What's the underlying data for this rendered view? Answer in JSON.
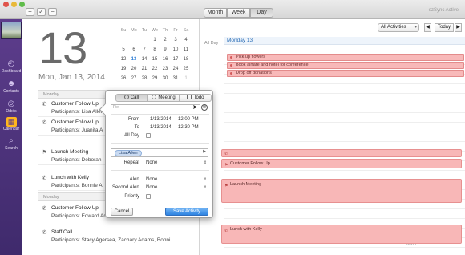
{
  "toolbar": {
    "add_label": "+",
    "check_label": "✓",
    "minus_label": "−",
    "view_modes": [
      "Month",
      "Week",
      "Day"
    ],
    "active_view": "Day",
    "brand": "ezSync Active"
  },
  "sidebar": {
    "items": [
      {
        "label": "Dashboard",
        "glyph": "⌚"
      },
      {
        "label": "Contacts",
        "glyph": "👥"
      },
      {
        "label": "Orbits",
        "glyph": "◍"
      },
      {
        "label": "Calendar",
        "glyph": "▦"
      },
      {
        "label": "Search",
        "glyph": "🔍"
      }
    ],
    "active": "Calendar"
  },
  "day_panel": {
    "big_day": "13",
    "date_line": "Mon, Jan 13, 2014"
  },
  "mini_calendar": {
    "headers": [
      "Su",
      "Mo",
      "Tu",
      "We",
      "Th",
      "Fr",
      "Sa"
    ],
    "weeks": [
      [
        "",
        "",
        "",
        "1",
        "2",
        "3",
        "4"
      ],
      [
        "5",
        "6",
        "7",
        "8",
        "9",
        "10",
        "11"
      ],
      [
        "12",
        "13",
        "14",
        "15",
        "16",
        "17",
        "18"
      ],
      [
        "19",
        "20",
        "21",
        "22",
        "23",
        "24",
        "25"
      ],
      [
        "26",
        "27",
        "28",
        "29",
        "30",
        "31",
        "1"
      ]
    ],
    "today": "13",
    "muted_last": "1"
  },
  "agenda": {
    "sections": [
      {
        "label": "Monday"
      },
      {
        "label": "Monday"
      }
    ],
    "items": [
      {
        "icon": "✆",
        "title": "Customer Follow Up",
        "sub": "Participants: Lisa Allen"
      },
      {
        "icon": "✆",
        "title": "Customer Follow Up",
        "sub": "Participants: Juanita A"
      },
      {
        "icon": "⚑",
        "title": "Launch Meeting",
        "sub": "Participants: Deborah"
      },
      {
        "icon": "✆",
        "title": "Lunch with Kelly",
        "sub": "Participants: Bonnie A"
      },
      {
        "icon": "✆",
        "title": "Customer Follow Up",
        "sub": "Participants: Edward Adams"
      },
      {
        "icon": "✆",
        "title": "Staff Call",
        "sub": "Participants: Stacy Agersea, Zachary Adams, Bonni..."
      }
    ]
  },
  "dayview": {
    "filter": "All Activities",
    "prev": "◀",
    "next": "▶",
    "today": "Today",
    "allday_label": "All Day",
    "day_header": "Monday 13",
    "noon_label": "Noon",
    "allday_events": [
      "Pick up flowers",
      "Book airfare and hotel for conference",
      "Drop off donations"
    ],
    "events": [
      {
        "icon": "✆",
        "title": ""
      },
      {
        "icon": "⚑",
        "title": "Customer Follow Up"
      },
      {
        "icon": "⚑",
        "title": "Launch Meeting"
      },
      {
        "icon": "✆",
        "title": "Lunch with Kelly"
      }
    ]
  },
  "popover": {
    "tabs": [
      "Call",
      "Meeting",
      "Todo"
    ],
    "active_tab": "Call",
    "title_placeholder": "Re.",
    "from_label": "From",
    "from_date": "1/13/2014",
    "from_time": "12:00 PM",
    "to_label": "To",
    "to_date": "1/13/2014",
    "to_time": "12:30 PM",
    "allday_label": "All Day",
    "participant": "Lisa Allen",
    "repeat_label": "Repeat",
    "repeat_value": "None",
    "alert_label": "Alert",
    "alert_value": "None",
    "second_alert_label": "Second Alert",
    "second_alert_value": "None",
    "priority_label": "Priority",
    "cancel": "Cancel",
    "save": "Save Activity"
  },
  "colors": {
    "sidebar": "#4f3479",
    "event_fill": "#f8b7b7",
    "accent": "#2f84e2",
    "highlight": "#ffb61e"
  }
}
